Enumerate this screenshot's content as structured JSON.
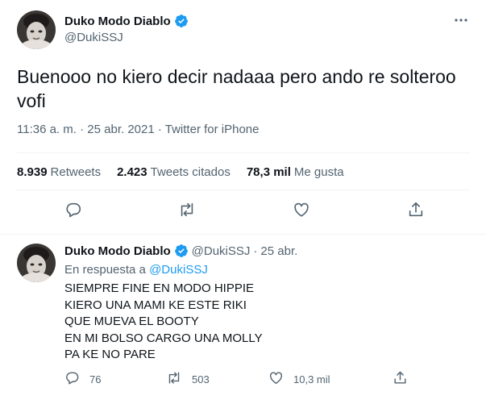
{
  "colors": {
    "accent": "#1d9bf0",
    "muted": "#536471",
    "text": "#0f1419",
    "border": "#eff3f4"
  },
  "main_tweet": {
    "display_name": "Duko Modo Diablo",
    "handle": "@DukiSSJ",
    "text": "Buenooo no kiero decir nadaaa pero ando re solteroo vofi",
    "time": "11:36 a. m.",
    "date": "25 abr. 2021",
    "source": "Twitter for iPhone",
    "stats": {
      "retweets_count": "8.939",
      "retweets_label": "Retweets",
      "quotes_count": "2.423",
      "quotes_label": "Tweets citados",
      "likes_count": "78,3 mil",
      "likes_label": "Me gusta"
    },
    "icons": [
      "reply-icon",
      "retweet-icon",
      "like-icon",
      "share-icon"
    ]
  },
  "reply_tweet": {
    "display_name": "Duko Modo Diablo",
    "handle": "@DukiSSJ",
    "time": "25 abr.",
    "reply_prefix": "En respuesta a",
    "reply_to": "@DukiSSJ",
    "lines": [
      "SIEMPRE FINE EN MODO HIPPIE",
      "KIERO UNA MAMI KE ESTE RIKI",
      "QUE MUEVA EL BOOTY",
      "EN MI BOLSO CARGO UNA MOLLY",
      "PA KE NO PARE"
    ],
    "counts": {
      "replies": "76",
      "retweets": "503",
      "likes": "10,3 mil"
    }
  }
}
